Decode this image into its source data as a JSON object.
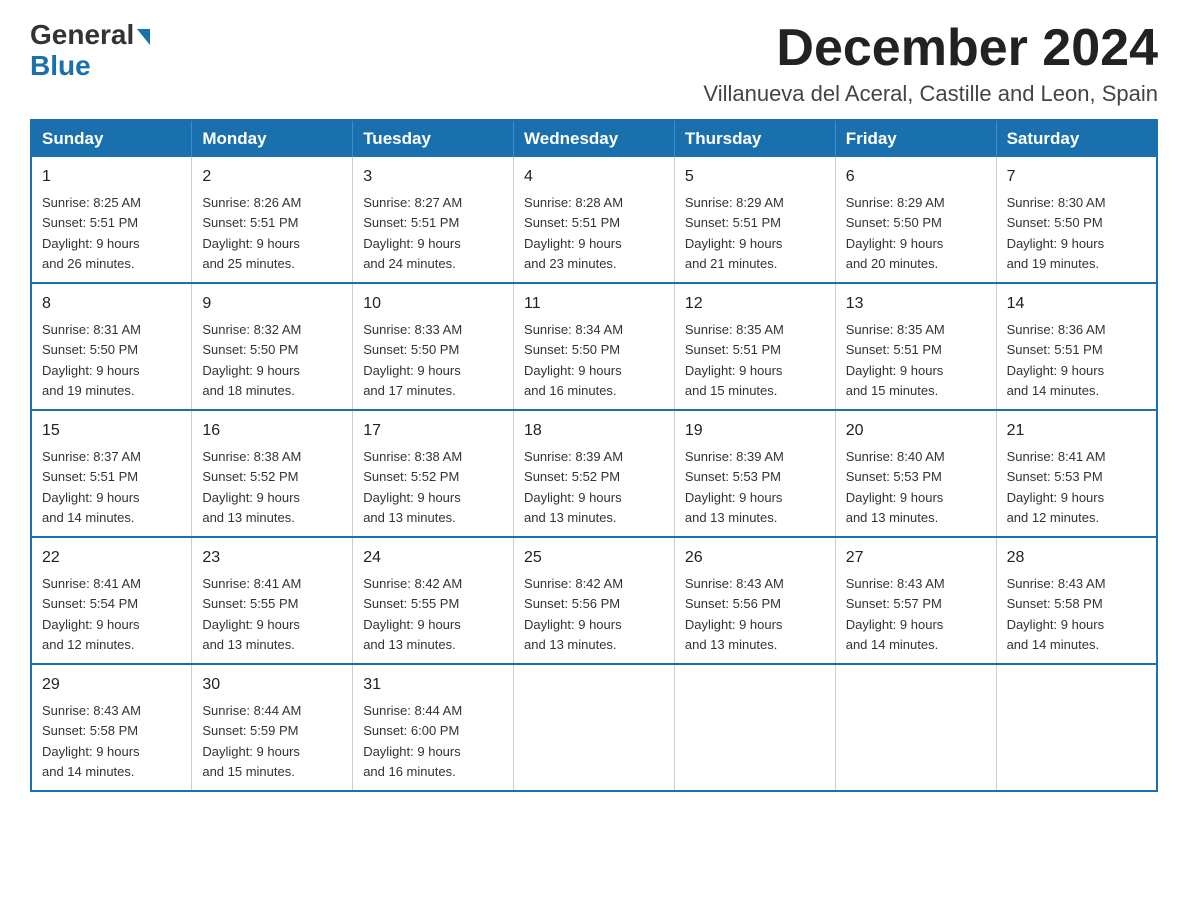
{
  "logo": {
    "general": "General",
    "blue": "Blue",
    "triangle": "▶"
  },
  "title": {
    "month_year": "December 2024",
    "location": "Villanueva del Aceral, Castille and Leon, Spain"
  },
  "weekdays": [
    "Sunday",
    "Monday",
    "Tuesday",
    "Wednesday",
    "Thursday",
    "Friday",
    "Saturday"
  ],
  "weeks": [
    [
      {
        "day": "1",
        "sunrise": "8:25 AM",
        "sunset": "5:51 PM",
        "daylight": "9 hours and 26 minutes."
      },
      {
        "day": "2",
        "sunrise": "8:26 AM",
        "sunset": "5:51 PM",
        "daylight": "9 hours and 25 minutes."
      },
      {
        "day": "3",
        "sunrise": "8:27 AM",
        "sunset": "5:51 PM",
        "daylight": "9 hours and 24 minutes."
      },
      {
        "day": "4",
        "sunrise": "8:28 AM",
        "sunset": "5:51 PM",
        "daylight": "9 hours and 23 minutes."
      },
      {
        "day": "5",
        "sunrise": "8:29 AM",
        "sunset": "5:51 PM",
        "daylight": "9 hours and 21 minutes."
      },
      {
        "day": "6",
        "sunrise": "8:29 AM",
        "sunset": "5:50 PM",
        "daylight": "9 hours and 20 minutes."
      },
      {
        "day": "7",
        "sunrise": "8:30 AM",
        "sunset": "5:50 PM",
        "daylight": "9 hours and 19 minutes."
      }
    ],
    [
      {
        "day": "8",
        "sunrise": "8:31 AM",
        "sunset": "5:50 PM",
        "daylight": "9 hours and 19 minutes."
      },
      {
        "day": "9",
        "sunrise": "8:32 AM",
        "sunset": "5:50 PM",
        "daylight": "9 hours and 18 minutes."
      },
      {
        "day": "10",
        "sunrise": "8:33 AM",
        "sunset": "5:50 PM",
        "daylight": "9 hours and 17 minutes."
      },
      {
        "day": "11",
        "sunrise": "8:34 AM",
        "sunset": "5:50 PM",
        "daylight": "9 hours and 16 minutes."
      },
      {
        "day": "12",
        "sunrise": "8:35 AM",
        "sunset": "5:51 PM",
        "daylight": "9 hours and 15 minutes."
      },
      {
        "day": "13",
        "sunrise": "8:35 AM",
        "sunset": "5:51 PM",
        "daylight": "9 hours and 15 minutes."
      },
      {
        "day": "14",
        "sunrise": "8:36 AM",
        "sunset": "5:51 PM",
        "daylight": "9 hours and 14 minutes."
      }
    ],
    [
      {
        "day": "15",
        "sunrise": "8:37 AM",
        "sunset": "5:51 PM",
        "daylight": "9 hours and 14 minutes."
      },
      {
        "day": "16",
        "sunrise": "8:38 AM",
        "sunset": "5:52 PM",
        "daylight": "9 hours and 13 minutes."
      },
      {
        "day": "17",
        "sunrise": "8:38 AM",
        "sunset": "5:52 PM",
        "daylight": "9 hours and 13 minutes."
      },
      {
        "day": "18",
        "sunrise": "8:39 AM",
        "sunset": "5:52 PM",
        "daylight": "9 hours and 13 minutes."
      },
      {
        "day": "19",
        "sunrise": "8:39 AM",
        "sunset": "5:53 PM",
        "daylight": "9 hours and 13 minutes."
      },
      {
        "day": "20",
        "sunrise": "8:40 AM",
        "sunset": "5:53 PM",
        "daylight": "9 hours and 13 minutes."
      },
      {
        "day": "21",
        "sunrise": "8:41 AM",
        "sunset": "5:53 PM",
        "daylight": "9 hours and 12 minutes."
      }
    ],
    [
      {
        "day": "22",
        "sunrise": "8:41 AM",
        "sunset": "5:54 PM",
        "daylight": "9 hours and 12 minutes."
      },
      {
        "day": "23",
        "sunrise": "8:41 AM",
        "sunset": "5:55 PM",
        "daylight": "9 hours and 13 minutes."
      },
      {
        "day": "24",
        "sunrise": "8:42 AM",
        "sunset": "5:55 PM",
        "daylight": "9 hours and 13 minutes."
      },
      {
        "day": "25",
        "sunrise": "8:42 AM",
        "sunset": "5:56 PM",
        "daylight": "9 hours and 13 minutes."
      },
      {
        "day": "26",
        "sunrise": "8:43 AM",
        "sunset": "5:56 PM",
        "daylight": "9 hours and 13 minutes."
      },
      {
        "day": "27",
        "sunrise": "8:43 AM",
        "sunset": "5:57 PM",
        "daylight": "9 hours and 14 minutes."
      },
      {
        "day": "28",
        "sunrise": "8:43 AM",
        "sunset": "5:58 PM",
        "daylight": "9 hours and 14 minutes."
      }
    ],
    [
      {
        "day": "29",
        "sunrise": "8:43 AM",
        "sunset": "5:58 PM",
        "daylight": "9 hours and 14 minutes."
      },
      {
        "day": "30",
        "sunrise": "8:44 AM",
        "sunset": "5:59 PM",
        "daylight": "9 hours and 15 minutes."
      },
      {
        "day": "31",
        "sunrise": "8:44 AM",
        "sunset": "6:00 PM",
        "daylight": "9 hours and 16 minutes."
      },
      null,
      null,
      null,
      null
    ]
  ],
  "labels": {
    "sunrise": "Sunrise:",
    "sunset": "Sunset:",
    "daylight": "Daylight:"
  }
}
